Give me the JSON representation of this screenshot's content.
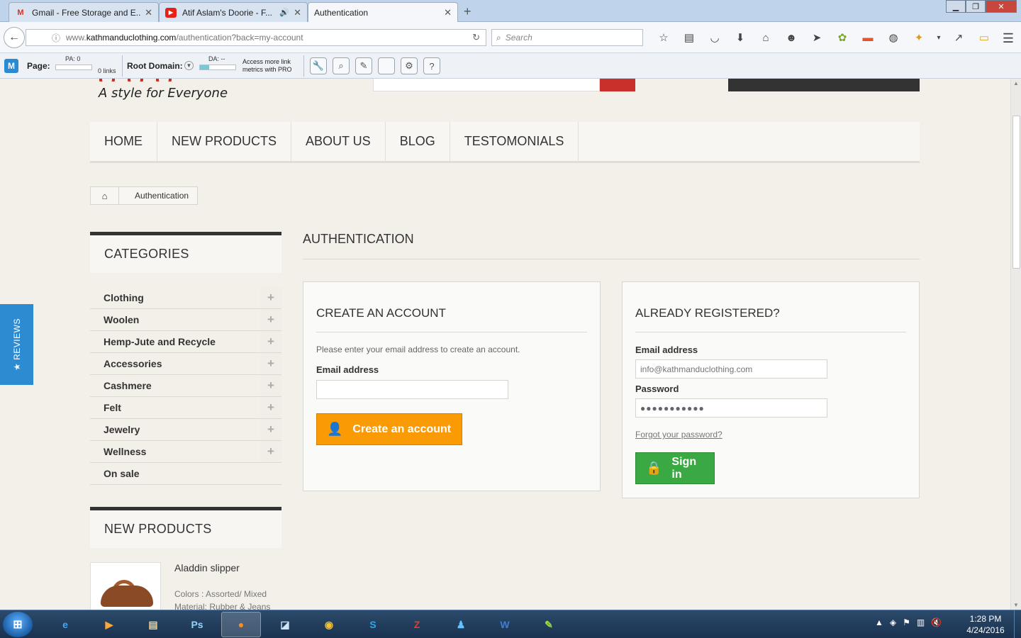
{
  "browser": {
    "tabs": [
      {
        "title": "Gmail - Free Storage and E...",
        "icon": "gmail-icon",
        "active": false
      },
      {
        "title": "Atif Aslam's Doorie - F...",
        "icon": "youtube-icon",
        "active": false,
        "audio": "speaker-icon"
      },
      {
        "title": "Authentication",
        "icon": "",
        "active": true
      }
    ],
    "new_tab": "+",
    "url_prefix": "www.",
    "url_domain": "kathmanduclothing.com",
    "url_path": "/authentication?back=my-account",
    "search_placeholder": "Search",
    "toolbar_icons": [
      "star-icon",
      "reading-list-icon",
      "pocket-icon",
      "download-icon",
      "home-icon",
      "chat-icon",
      "send-icon",
      "extension-flower-icon",
      "extension-brush-icon",
      "globe-icon",
      "extension-puzzle-icon",
      "dropdown-icon",
      "pin-icon",
      "notes-icon"
    ]
  },
  "mozbar": {
    "page_label": "Page:",
    "pa": "PA: 0",
    "links": "0 links",
    "root_domain_label": "Root Domain:",
    "da": "DA: --",
    "da_fill": 0.25,
    "pro_text_1": "Access more link",
    "pro_text_2": "metrics with PRO"
  },
  "site": {
    "tagline": "A style for Everyone",
    "nav": [
      "HOME",
      "NEW PRODUCTS",
      "ABOUT US",
      "BLOG",
      "TESTOMONIALS"
    ],
    "breadcrumb": "Authentication",
    "categories_title": "CATEGORIES",
    "categories": [
      {
        "name": "Clothing",
        "expandable": true
      },
      {
        "name": "Woolen",
        "expandable": true
      },
      {
        "name": "Hemp-Jute and Recycle",
        "expandable": true
      },
      {
        "name": "Accessories",
        "expandable": true
      },
      {
        "name": "Cashmere",
        "expandable": true
      },
      {
        "name": "Felt",
        "expandable": true
      },
      {
        "name": "Jewelry",
        "expandable": true
      },
      {
        "name": "Wellness",
        "expandable": true
      },
      {
        "name": "On sale",
        "expandable": false
      }
    ],
    "new_products_title": "NEW PRODUCTS",
    "product": {
      "name": "Aladdin slipper",
      "colors": "Colors : Assorted/ Mixed",
      "material": "Material: Rubber & Jeans"
    },
    "page_title": "AUTHENTICATION",
    "create": {
      "title": "CREATE AN ACCOUNT",
      "intro": "Please enter your email address to create an account.",
      "email_label": "Email address",
      "email_value": "",
      "button": "Create an account"
    },
    "login": {
      "title": "ALREADY REGISTERED?",
      "email_label": "Email address",
      "email_placeholder": "info@kathmanduclothing.com",
      "password_label": "Password",
      "password_value": "●●●●●●●●●●●",
      "forgot": "Forgot your password?",
      "button": "Sign in"
    },
    "reviews_tab": "★ REVIEWS"
  },
  "taskbar": {
    "apps": [
      {
        "name": "internet-explorer-icon",
        "glyph": "e",
        "color": "#3ea6ff"
      },
      {
        "name": "media-player-icon",
        "glyph": "▶",
        "color": "#f7a93a"
      },
      {
        "name": "file-explorer-icon",
        "glyph": "▤",
        "color": "#f4d27a"
      },
      {
        "name": "photoshop-icon",
        "glyph": "Ps",
        "color": "#8fd3ff"
      },
      {
        "name": "firefox-icon",
        "glyph": "●",
        "color": "#ff8a1f",
        "active": true
      },
      {
        "name": "notes-app-icon",
        "glyph": "◪",
        "color": "#cfe4f7"
      },
      {
        "name": "chrome-icon",
        "glyph": "◉",
        "color": "#f2c230"
      },
      {
        "name": "skype-icon",
        "glyph": "S",
        "color": "#28a9f0"
      },
      {
        "name": "filezilla-icon",
        "glyph": "Z",
        "color": "#e43c2c"
      },
      {
        "name": "people-app-icon",
        "glyph": "♟",
        "color": "#5fc4ff"
      },
      {
        "name": "word-icon",
        "glyph": "W",
        "color": "#3f7fd1"
      },
      {
        "name": "notepad-plus-icon",
        "glyph": "✎",
        "color": "#9bd84c"
      }
    ],
    "time": "1:28 PM",
    "date": "4/24/2016"
  }
}
